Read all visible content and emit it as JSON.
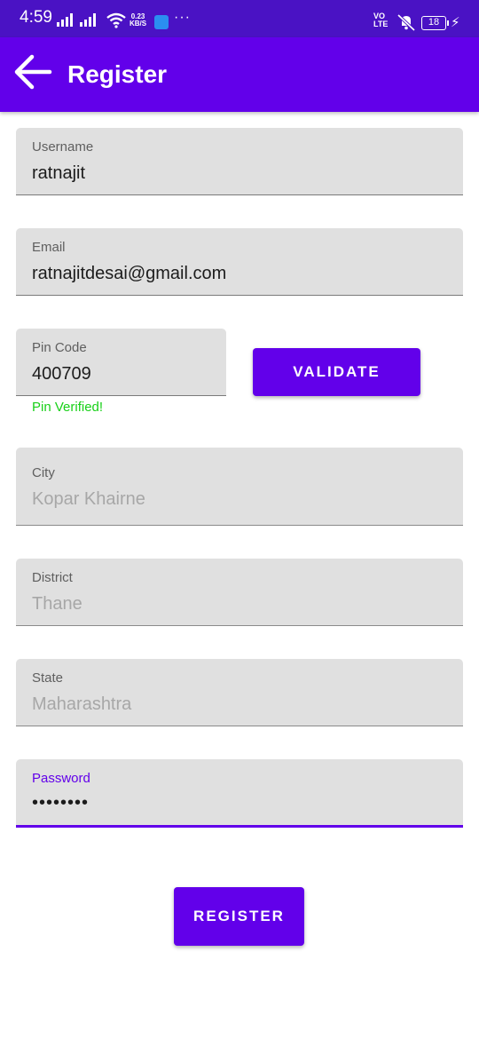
{
  "status_bar": {
    "time": "4:59",
    "net_speed_value": "0.23",
    "net_speed_unit": "KB/S",
    "volte_line1": "VO",
    "volte_line2": "LTE",
    "battery": "18",
    "more": "···"
  },
  "app_bar": {
    "title": "Register",
    "background": "#6200ea"
  },
  "form": {
    "username": {
      "label": "Username",
      "value": "ratnajit"
    },
    "email": {
      "label": "Email",
      "value": "ratnajitdesai@gmail.com"
    },
    "pin_code": {
      "label": "Pin Code",
      "value": "400709",
      "helper": "Pin Verified!"
    },
    "validate_label": "VALIDATE",
    "city": {
      "label": "City",
      "value": "Kopar Khairne"
    },
    "district": {
      "label": "District",
      "value": "Thane"
    },
    "state": {
      "label": "State",
      "value": "Maharashtra"
    },
    "password": {
      "label": "Password",
      "value": "••••••••"
    },
    "register_label": "REGISTER"
  },
  "colors": {
    "primary": "#6200ea",
    "status_bar": "#4a12c4",
    "success": "#18d018",
    "field_fill": "#e0e0e0"
  },
  "icons": [
    "back-arrow-icon",
    "wifi-icon",
    "signal-icon",
    "mute-icon",
    "battery-icon",
    "charging-icon"
  ]
}
